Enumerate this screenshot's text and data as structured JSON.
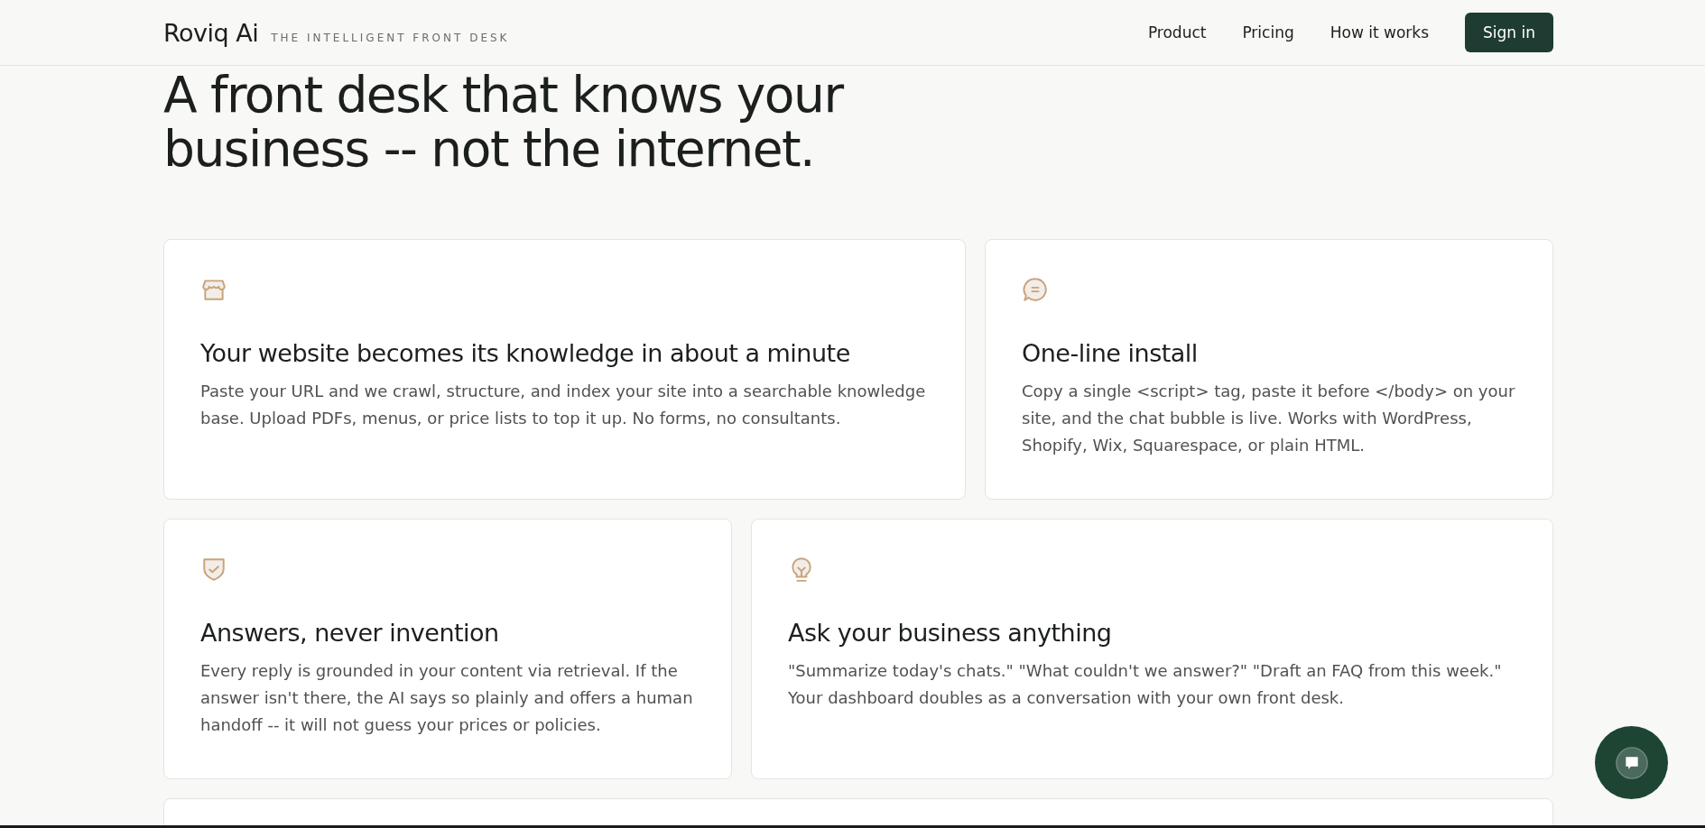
{
  "header": {
    "brand": "Roviq Ai",
    "tagline": "THE INTELLIGENT FRONT DESK",
    "nav": [
      "Product",
      "Pricing",
      "How it works"
    ],
    "cta": "Sign in"
  },
  "hero": {
    "title": "A front desk that knows your business -- not the internet."
  },
  "features": [
    {
      "kind": "store",
      "title": "Your website becomes its knowledge in about a minute",
      "text": "Paste your URL and we crawl, structure, and index your site into a searchable knowledge base. Upload PDFs, menus, or price lists to top it up. No forms, no consultants."
    },
    {
      "kind": "chat",
      "title": "One-line install",
      "text": "Copy a single <script> tag, paste it before </body> on your site, and the chat bubble is live. Works with WordPress, Shopify, Wix, Squarespace, or plain HTML."
    },
    {
      "kind": "shield",
      "title": "Answers, never invention",
      "text": "Every reply is grounded in your content via retrieval. If the answer isn't there, the AI says so plainly and offers a human handoff -- it will not guess your prices or policies."
    },
    {
      "kind": "bulb",
      "title": "Ask your business anything",
      "text": "\"Summarize today's chats.\" \"What couldn't we answer?\" \"Draft an FAQ from this week.\" Your dashboard doubles as a conversation with your own front desk."
    }
  ]
}
